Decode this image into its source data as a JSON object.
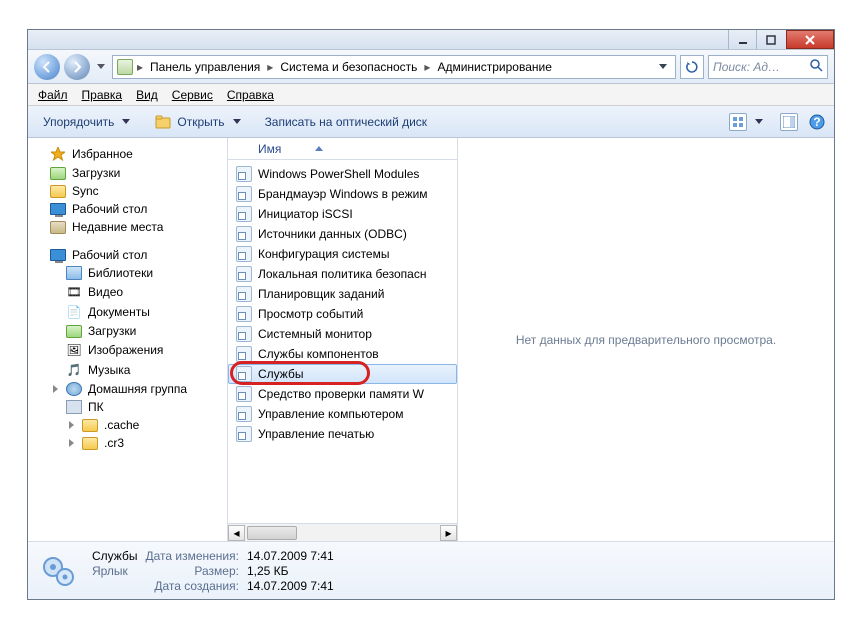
{
  "titlebar": {},
  "breadcrumb": {
    "seg1": "Панель управления",
    "seg2": "Система и безопасность",
    "seg3": "Администрирование",
    "search_placeholder": "Поиск: Ад…"
  },
  "menu": {
    "file": "Файл",
    "edit": "Правка",
    "view": "Вид",
    "tools": "Сервис",
    "help": "Справка"
  },
  "toolbar": {
    "organize": "Упорядочить",
    "open": "Открыть",
    "burn": "Записать на оптический диск"
  },
  "nav": {
    "favorites": "Избранное",
    "downloads": "Загрузки",
    "sync": "Sync",
    "desktop": "Рабочий стол",
    "recent": "Недавние места",
    "desktop_root": "Рабочий стол",
    "libraries": "Библиотеки",
    "video": "Видео",
    "documents": "Документы",
    "downloads2": "Загрузки",
    "pictures": "Изображения",
    "music": "Музыка",
    "homegroup": "Домашняя группа",
    "pc": "ПК",
    "cache": ".cache",
    "cr3": ".cr3"
  },
  "filelist": {
    "col_name": "Имя",
    "items": [
      "Windows PowerShell Modules",
      "Брандмауэр Windows в режим",
      "Инициатор iSCSI",
      "Источники данных (ODBC)",
      "Конфигурация системы",
      "Локальная политика безопасн",
      "Планировщик заданий",
      "Просмотр событий",
      "Системный монитор",
      "Службы компонентов",
      "Службы",
      "Средство проверки памяти W",
      "Управление компьютером",
      "Управление печатью"
    ]
  },
  "preview": {
    "empty": "Нет данных для предварительного просмотра."
  },
  "details": {
    "name": "Службы",
    "type": "Ярлык",
    "mod_label": "Дата изменения:",
    "mod_val": "14.07.2009 7:41",
    "size_label": "Размер:",
    "size_val": "1,25 КБ",
    "created_label": "Дата создания:",
    "created_val": "14.07.2009 7:41"
  }
}
